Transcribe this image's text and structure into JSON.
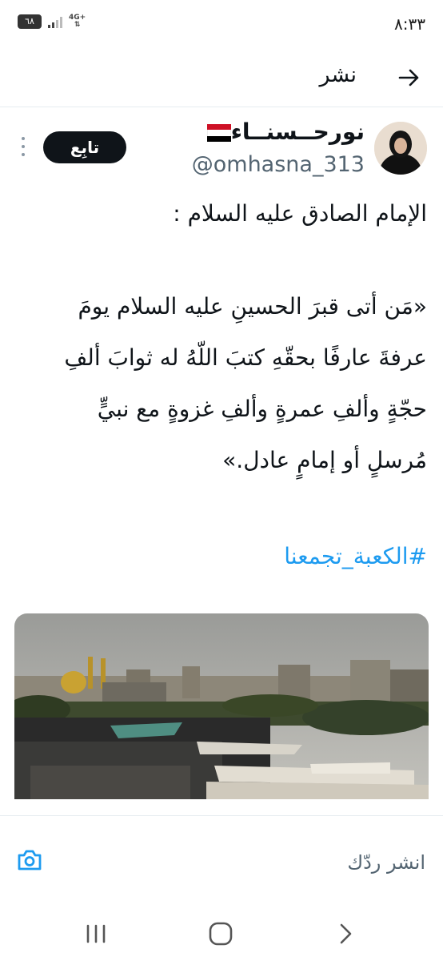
{
  "status_bar": {
    "time": "٨:٣٣",
    "battery": "٦٨",
    "network": "4G+"
  },
  "header": {
    "title": "نشر",
    "back_icon": "arrow-right-icon"
  },
  "tweet": {
    "display_name": "نورحــسنــاء",
    "flag_icon": "iraq-flag-icon",
    "username": "@omhasna_313",
    "follow_label": "تابِع",
    "lines": [
      "الإمام الصادق عليه السلام :",
      "«مَن أتى قبرَ الحسينِ عليه السلام يومَ",
      "عرفةَ عارفًا بحقّهِ كتبَ اللّهُ له ثوابَ ألفِ",
      "حجّةٍ وألفِ عمرةٍ وألفِ غزوةٍ مع نبيٍّ",
      "مُرسلٍ أو إمامٍ عادل.»"
    ],
    "hashtag": "#الكعبة_تجمعنا"
  },
  "reply": {
    "placeholder": "انشر ردّك",
    "camera_icon": "camera-icon"
  },
  "nav": {
    "recents_icon": "recents-icon",
    "home_icon": "home-icon",
    "back_icon": "back-chevron-icon"
  },
  "colors": {
    "link": "#1d9bf0",
    "text": "#0f1419",
    "muted": "#536471",
    "follow_bg": "#0f1419"
  }
}
